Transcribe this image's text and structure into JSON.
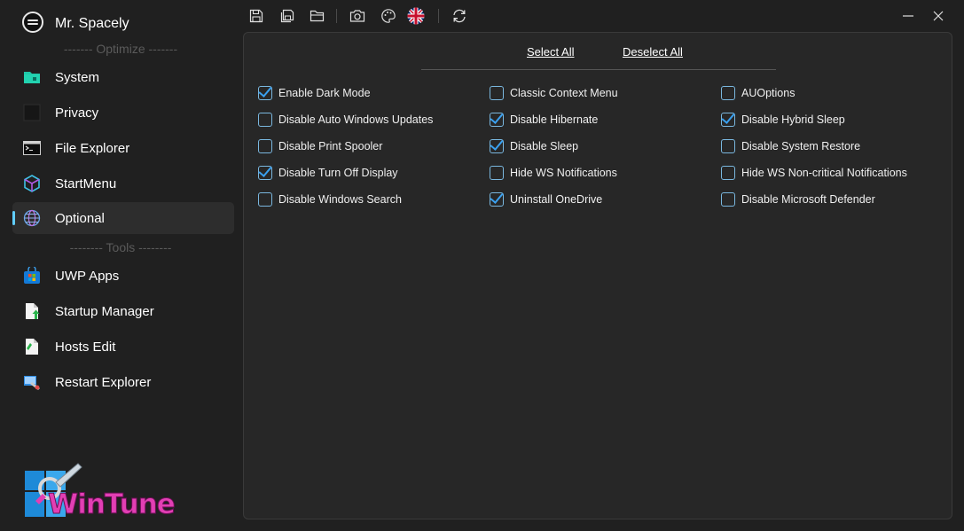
{
  "profile": {
    "name": "Mr. Spacely"
  },
  "sidebar": {
    "sep_optimize": "------- Optimize -------",
    "sep_tools": "-------- Tools --------",
    "items": [
      {
        "label": "System",
        "icon": "folder-icon"
      },
      {
        "label": "Privacy",
        "icon": "privacy-icon"
      },
      {
        "label": "File Explorer",
        "icon": "terminal-icon"
      },
      {
        "label": "StartMenu",
        "icon": "cube-icon"
      },
      {
        "label": "Optional",
        "icon": "globe-icon",
        "active": true
      },
      {
        "label": "UWP Apps",
        "icon": "store-icon"
      },
      {
        "label": "Startup Manager",
        "icon": "startup-icon"
      },
      {
        "label": "Hosts Edit",
        "icon": "hosts-icon"
      },
      {
        "label": "Restart Explorer",
        "icon": "restart-icon"
      }
    ]
  },
  "logo": {
    "text": "WinTune"
  },
  "toolbar": {
    "icons": [
      "save-icon",
      "save-all-icon",
      "open-folder-icon",
      "camera-icon",
      "palette-icon",
      "uk-flag-icon",
      "refresh-icon"
    ]
  },
  "panel": {
    "select_all": "Select All",
    "deselect_all": "Deselect All",
    "options": [
      [
        {
          "label": "Enable Dark Mode",
          "checked": true
        },
        {
          "label": "Disable Auto Windows Updates",
          "checked": false
        },
        {
          "label": "Disable Print Spooler",
          "checked": false
        },
        {
          "label": "Disable Turn Off Display",
          "checked": true
        },
        {
          "label": "Disable Windows Search",
          "checked": false
        }
      ],
      [
        {
          "label": "Classic Context Menu",
          "checked": false
        },
        {
          "label": "Disable Hibernate",
          "checked": true
        },
        {
          "label": "Disable Sleep",
          "checked": true
        },
        {
          "label": "Hide WS Notifications",
          "checked": false
        },
        {
          "label": "Uninstall OneDrive",
          "checked": true
        }
      ],
      [
        {
          "label": "AUOptions",
          "checked": false
        },
        {
          "label": "Disable Hybrid Sleep",
          "checked": true
        },
        {
          "label": "Disable System Restore",
          "checked": false
        },
        {
          "label": "Hide WS Non-critical Notifications",
          "checked": false
        },
        {
          "label": "Disable Microsoft Defender",
          "checked": false
        }
      ]
    ]
  },
  "colors": {
    "accent": "#60cdff",
    "checkbox": "#3aa0ef",
    "logo": "#e23fb4"
  }
}
